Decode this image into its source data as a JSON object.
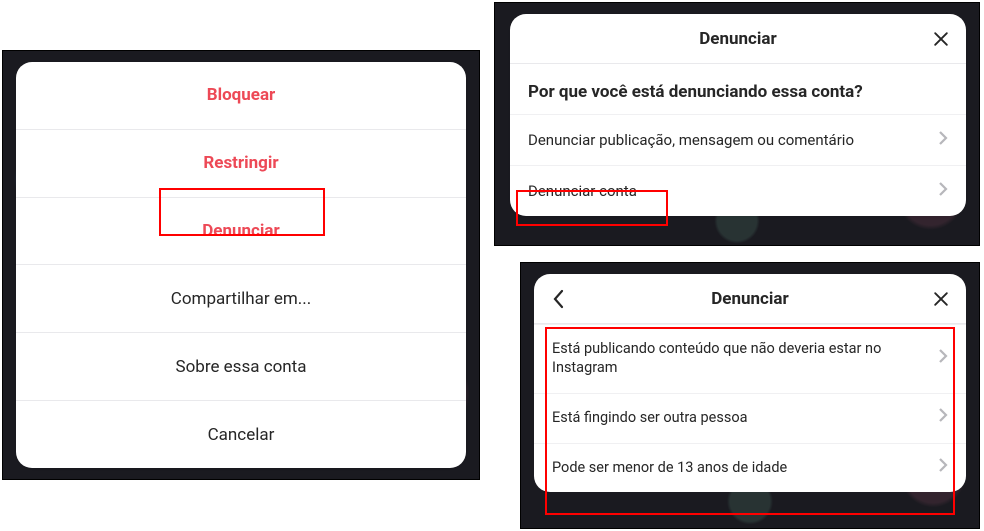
{
  "panel1": {
    "items": [
      {
        "label": "Bloquear",
        "danger": true
      },
      {
        "label": "Restringir",
        "danger": true
      },
      {
        "label": "Denunciar",
        "danger": true
      },
      {
        "label": "Compartilhar em...",
        "danger": false
      },
      {
        "label": "Sobre essa conta",
        "danger": false
      },
      {
        "label": "Cancelar",
        "danger": false
      }
    ]
  },
  "panel2": {
    "title": "Denunciar",
    "question": "Por que você está denunciando essa conta?",
    "options": [
      "Denunciar publicação, mensagem ou comentário",
      "Denunciar conta"
    ]
  },
  "panel3": {
    "title": "Denunciar",
    "options": [
      "Está publicando conteúdo que não deveria estar no Instagram",
      "Está fingindo ser outra pessoa",
      "Pode ser menor de 13 anos de idade"
    ]
  }
}
